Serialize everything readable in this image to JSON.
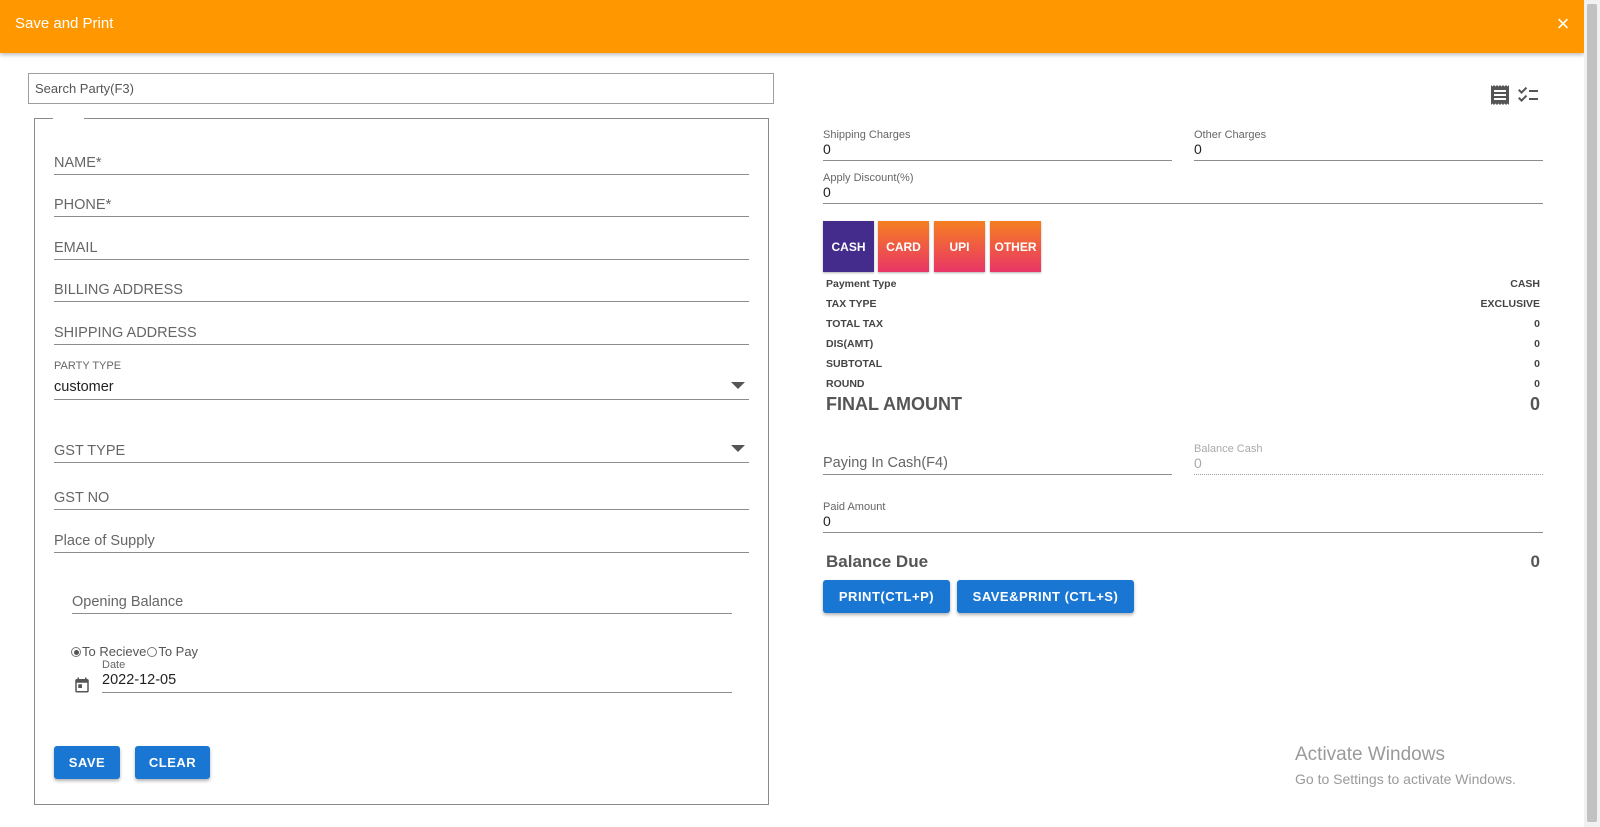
{
  "header": {
    "title": "Save and Print",
    "close_icon": "×"
  },
  "search": {
    "placeholder": "Search Party(F3)"
  },
  "party_form": {
    "name_placeholder": "NAME*",
    "phone_placeholder": "PHONE*",
    "email_placeholder": "EMAIL",
    "billing_address_placeholder": "BILLING ADDRESS",
    "shipping_address_placeholder": "SHIPPING ADDRESS",
    "party_type": {
      "label": "PARTY TYPE",
      "value": "customer"
    },
    "gst_type_placeholder": "GST TYPE",
    "gst_no_placeholder": "GST NO",
    "place_of_supply_placeholder": "Place of Supply",
    "opening_balance_placeholder": "Opening Balance",
    "radio": {
      "to_receive": "To Recieve",
      "to_pay": "To Pay",
      "selected": "to_receive"
    },
    "date": {
      "label": "Date",
      "value": "2022-12-05"
    },
    "save_label": "SAVE",
    "clear_label": "CLEAR"
  },
  "charges": {
    "shipping": {
      "label": "Shipping Charges",
      "value": "0"
    },
    "other": {
      "label": "Other Charges",
      "value": "0"
    },
    "discount": {
      "label": "Apply Discount(%)",
      "value": "0"
    }
  },
  "payment_methods": [
    {
      "label": "CASH",
      "active": true
    },
    {
      "label": "CARD",
      "active": false
    },
    {
      "label": "UPI",
      "active": false
    },
    {
      "label": "OTHER",
      "active": false
    }
  ],
  "summary": [
    {
      "label": "Payment Type",
      "value": "CASH"
    },
    {
      "label": "TAX TYPE",
      "value": "EXCLUSIVE"
    },
    {
      "label": "TOTAL TAX",
      "value": "0"
    },
    {
      "label": "DIS(AMT)",
      "value": "0"
    },
    {
      "label": "SUBTOTAL",
      "value": "0"
    },
    {
      "label": "ROUND",
      "value": "0"
    }
  ],
  "final_amount": {
    "label": "FINAL AMOUNT",
    "value": "0"
  },
  "paying": {
    "paying_in_cash_placeholder": "Paying In Cash(F4)",
    "balance_cash": {
      "label": "Balance Cash",
      "value": "0"
    },
    "paid_amount": {
      "label": "Paid Amount",
      "value": "0"
    }
  },
  "balance_due": {
    "label": "Balance Due",
    "value": "0"
  },
  "actions": {
    "print_label": "PRINT(CTL+P)",
    "save_print_label": "SAVE&PRINT (CTL+S)"
  },
  "icons": {
    "receipt": "receipt-icon",
    "checklist": "checklist-icon",
    "calendar": "calendar-icon"
  },
  "colors": {
    "header": "#ff9800",
    "primary_button": "#1976d2",
    "cash_active": "#432c8c",
    "pay_gradient_top": "#f57f20",
    "pay_gradient_bottom": "#e93567"
  },
  "watermark": {
    "line1": "Activate Windows",
    "line2": "Go to Settings to activate Windows."
  }
}
